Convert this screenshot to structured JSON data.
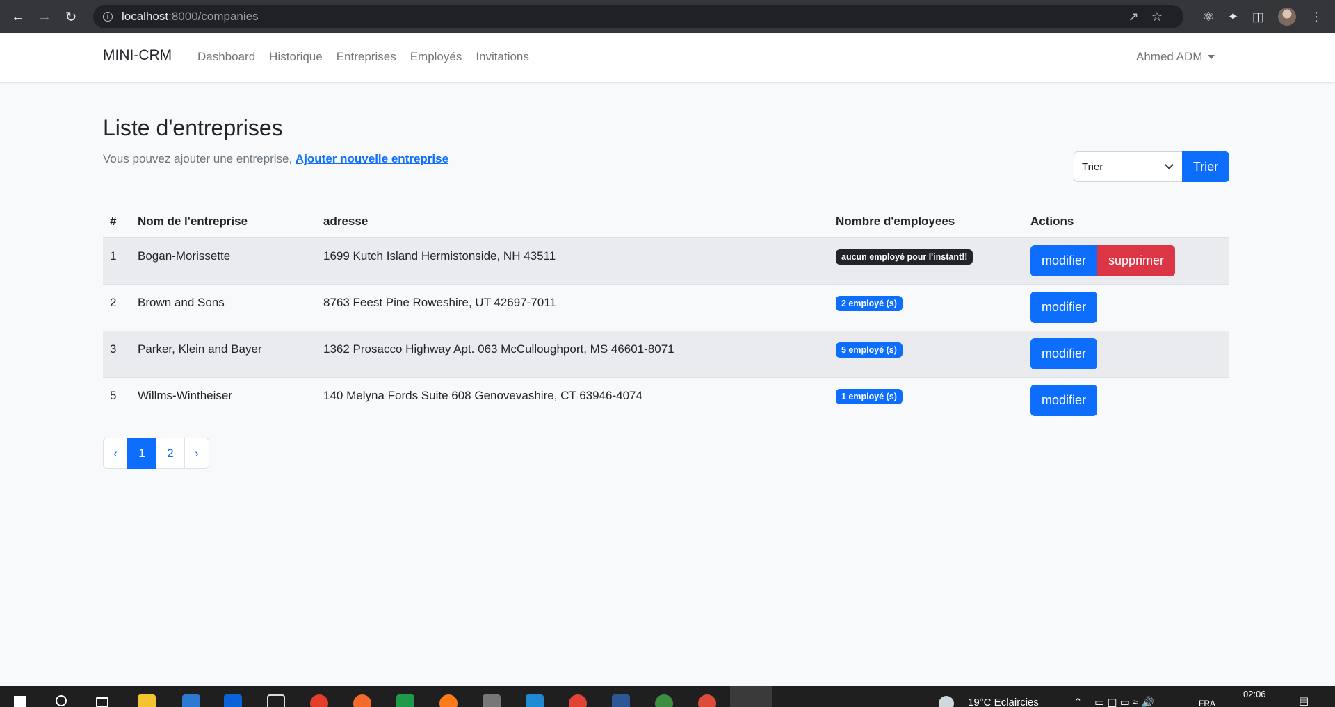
{
  "browser": {
    "url_host": "localhost",
    "url_path": ":8000/companies"
  },
  "navbar": {
    "brand": "MINI-CRM",
    "links": [
      "Dashboard",
      "Historique",
      "Entreprises",
      "Employés",
      "Invitations"
    ],
    "user": "Ahmed ADM"
  },
  "page": {
    "title": "Liste d'entreprises",
    "subtitle": "Vous pouvez ajouter une entreprise,",
    "add_link": "Ajouter nouvelle entreprise"
  },
  "sort": {
    "selected": "Trier",
    "button": "Trier"
  },
  "table": {
    "headers": [
      "#",
      "Nom de l'entreprise",
      "adresse",
      "Nombre d'employees",
      "Actions"
    ],
    "rows": [
      {
        "id": "1",
        "name": "Bogan-Morissette",
        "address": "1699 Kutch Island Hermistonside, NH 43511",
        "employees": "aucun employé pour l'instant!!",
        "edit": "modifier",
        "delete": "supprimer"
      },
      {
        "id": "2",
        "name": "Brown and Sons",
        "address": "8763 Feest Pine Roweshire, UT 42697-7011",
        "employees": "2 employé (s)",
        "edit": "modifier"
      },
      {
        "id": "3",
        "name": "Parker, Klein and Bayer",
        "address": "1362 Prosacco Highway Apt. 063 McCulloughport, MS 46601-8071",
        "employees": "5 employé (s)",
        "edit": "modifier"
      },
      {
        "id": "5",
        "name": "Willms-Wintheiser",
        "address": "140 Melyna Fords Suite 608 Genovevashire, CT 63946-4074",
        "employees": "1 employé (s)",
        "edit": "modifier"
      }
    ]
  },
  "pagination": {
    "prev": "‹",
    "pages": [
      "1",
      "2"
    ],
    "next": "›",
    "active": "1"
  },
  "taskbar": {
    "weather": "19°C  Eclaircies",
    "lang": "FRA",
    "time": "02:06"
  },
  "colors": {
    "primary": "#0d6efd",
    "danger": "#dc3545",
    "dark": "#212529"
  }
}
